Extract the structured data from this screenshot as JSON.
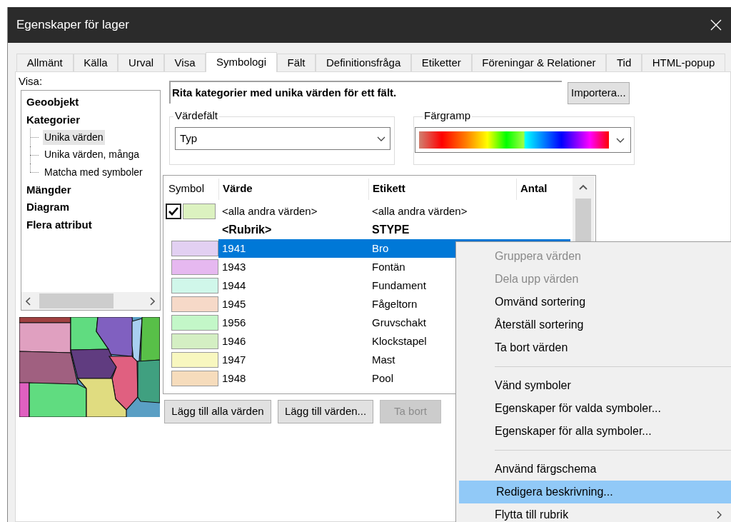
{
  "window": {
    "title": "Egenskaper för lager"
  },
  "tabs": [
    {
      "label": "Allmänt",
      "selected": false
    },
    {
      "label": "Källa",
      "selected": false
    },
    {
      "label": "Urval",
      "selected": false
    },
    {
      "label": "Visa",
      "selected": false
    },
    {
      "label": "Symbologi",
      "selected": true
    },
    {
      "label": "Fält",
      "selected": false
    },
    {
      "label": "Definitionsfråga",
      "selected": false
    },
    {
      "label": "Etiketter",
      "selected": false
    },
    {
      "label": "Föreningar & Relationer",
      "selected": false
    },
    {
      "label": "Tid",
      "selected": false
    },
    {
      "label": "HTML-popup",
      "selected": false
    }
  ],
  "show_panel": {
    "label": "Visa:",
    "tree": [
      {
        "label": "Geoobjekt"
      },
      {
        "label": "Kategorier",
        "children": [
          {
            "label": "Unika värden",
            "selected": true
          },
          {
            "label": "Unika värden, många",
            "selected": false
          },
          {
            "label": "Matcha med symboler",
            "selected": false
          }
        ]
      },
      {
        "label": "Mängder"
      },
      {
        "label": "Diagram"
      },
      {
        "label": "Flera attribut"
      }
    ]
  },
  "description": "Rita kategorier med unika värden för ett fält.",
  "import_button": "Importera...",
  "value_field": {
    "legend": "Värdefält",
    "value": "Typ"
  },
  "color_ramp": {
    "legend": "Färgramp"
  },
  "table": {
    "columns": [
      "Symbol",
      "Värde",
      "Etikett",
      "Antal"
    ],
    "rows": [
      {
        "kind": "other",
        "checked": true,
        "color": "#dcf2c0",
        "value": "<alla andra värden>",
        "label": "<alla andra värden>"
      },
      {
        "kind": "heading",
        "value": "<Rubrik>",
        "label": "STYPE"
      },
      {
        "kind": "value",
        "color": "#e2d0f2",
        "value": "1941",
        "label": "Bro",
        "selected": true
      },
      {
        "kind": "value",
        "color": "#e6b8f0",
        "value": "1943",
        "label": "Fontän",
        "selected": false
      },
      {
        "kind": "value",
        "color": "#d0f7ea",
        "value": "1944",
        "label": "Fundament",
        "selected": false
      },
      {
        "kind": "value",
        "color": "#f6d9c8",
        "value": "1945",
        "label": "Fågeltorn",
        "selected": false
      },
      {
        "kind": "value",
        "color": "#c3f7c8",
        "value": "1956",
        "label": "Gruvschakt",
        "selected": false
      },
      {
        "kind": "value",
        "color": "#d4efc3",
        "value": "1946",
        "label": "Klockstapel",
        "selected": false
      },
      {
        "kind": "value",
        "color": "#f8f7bf",
        "value": "1947",
        "label": "Mast",
        "selected": false
      },
      {
        "kind": "value",
        "color": "#f6dcbc",
        "value": "1948",
        "label": "Pool",
        "selected": false
      }
    ]
  },
  "buttons": [
    {
      "label": "Lägg till alla värden",
      "disabled": false
    },
    {
      "label": "Lägg till värden...",
      "disabled": false
    },
    {
      "label": "Ta bort",
      "disabled": true
    }
  ],
  "context_menu": {
    "items": [
      {
        "kind": "item",
        "label": "Gruppera värden",
        "disabled": true,
        "selected": false
      },
      {
        "kind": "item",
        "label": "Dela upp värden",
        "disabled": true,
        "selected": false
      },
      {
        "kind": "item",
        "label": "Omvänd sortering",
        "disabled": false,
        "selected": false
      },
      {
        "kind": "item",
        "label": "Återställ sortering",
        "disabled": false,
        "selected": false
      },
      {
        "kind": "item",
        "label": "Ta bort värden",
        "disabled": false,
        "selected": false
      },
      {
        "kind": "separator"
      },
      {
        "kind": "item",
        "label": "Vänd symboler",
        "disabled": false,
        "selected": false
      },
      {
        "kind": "item",
        "label": "Egenskaper för valda symboler...",
        "disabled": false,
        "selected": false
      },
      {
        "kind": "item",
        "label": "Egenskaper för alla symboler...",
        "disabled": false,
        "selected": false
      },
      {
        "kind": "separator"
      },
      {
        "kind": "item",
        "label": "Använd färgschema",
        "disabled": false,
        "selected": false
      },
      {
        "kind": "item",
        "label": "Redigera beskrivning...",
        "disabled": false,
        "selected": true
      },
      {
        "kind": "item",
        "label": "Flytta till rubrik",
        "disabled": false,
        "selected": false,
        "submenu": true
      }
    ]
  }
}
